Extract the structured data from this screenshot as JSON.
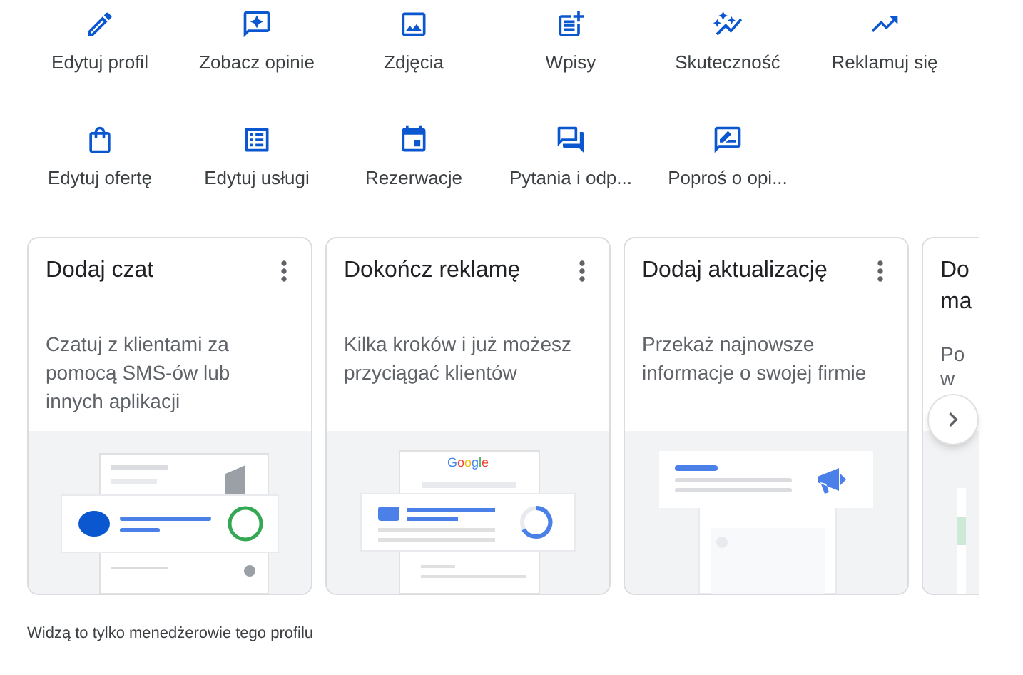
{
  "actions": [
    {
      "kind": "edit",
      "label": "Edytuj profil"
    },
    {
      "kind": "reviews",
      "label": "Zobacz opinie"
    },
    {
      "kind": "photo",
      "label": "Zdjęcia"
    },
    {
      "kind": "post",
      "label": "Wpisy"
    },
    {
      "kind": "graph",
      "label": "Skuteczność"
    },
    {
      "kind": "trend",
      "label": "Reklamuj się"
    },
    {
      "kind": "bag",
      "label": "Edytuj ofertę"
    },
    {
      "kind": "list",
      "label": "Edytuj usługi"
    },
    {
      "kind": "event",
      "label": "Rezerwacje"
    },
    {
      "kind": "forum",
      "label": "Pytania i odp..."
    },
    {
      "kind": "rate",
      "label": "Poproś o opi..."
    }
  ],
  "cards": [
    {
      "kind": "chat",
      "title": "Dodaj czat",
      "body": "Czatuj z klientami za pomocą SMS-ów lub innych aplikacji"
    },
    {
      "kind": "ad",
      "title": "Dokończ reklamę",
      "body": "Kilka kroków i już możesz przyciągać klientów",
      "illustration_text": "Google"
    },
    {
      "kind": "update",
      "title": "Dodaj aktualizację",
      "body": "Przekaż najnowsze informacje o swojej firmie"
    },
    {
      "kind": "partial",
      "title_lines": [
        "Do",
        "ma"
      ],
      "body_lines": [
        "Po",
        "w"
      ]
    }
  ],
  "footer": "Widzą to tylko menedżerowie tego profilu"
}
